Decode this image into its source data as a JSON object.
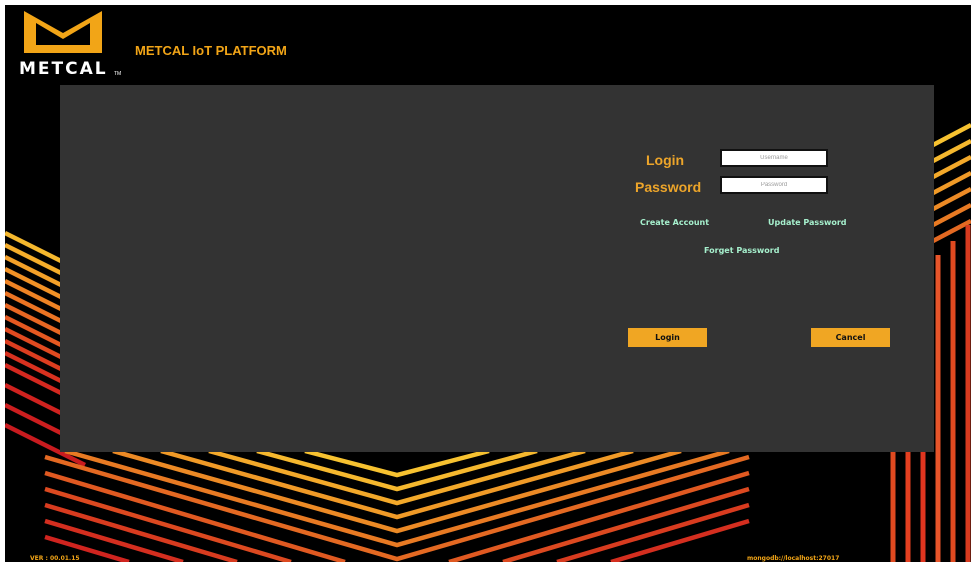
{
  "header": {
    "brand_word": "METCAL",
    "brand_tm": "TM",
    "app_title": "METCAL IoT PLATFORM"
  },
  "login_form": {
    "login_label": "Login",
    "username_placeholder": "Username",
    "password_label": "Password",
    "password_placeholder": "Password",
    "create_account": "Create Account",
    "update_password": "Update Password",
    "forget_password": "Forget Password",
    "login_button": "Login",
    "cancel_button": "Cancel"
  },
  "footer": {
    "version": "VER : 00.01.15",
    "db_connection": "mongodb://localhost:27017"
  },
  "colors": {
    "accent": "#f0a623",
    "link": "#a6f0cd",
    "panel": "#333333",
    "background": "#000000"
  }
}
